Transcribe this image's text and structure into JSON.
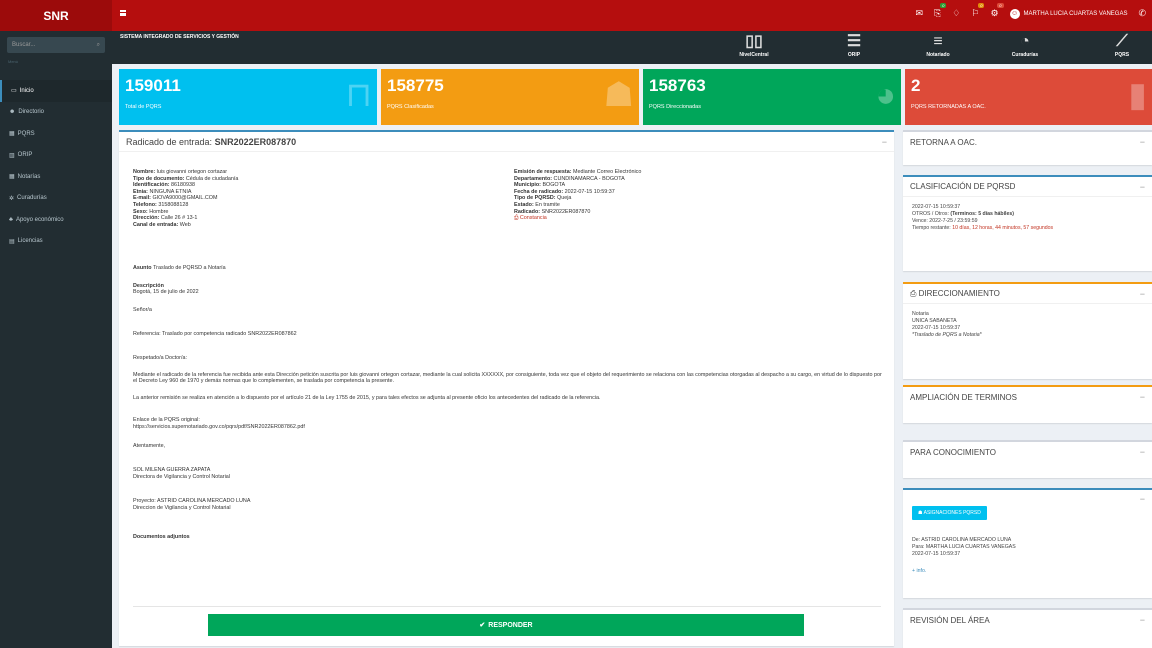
{
  "header": {
    "logo": "SNR",
    "user_name": "MARTHA LUCIA CUARTAS VANEGAS",
    "badges": {
      "b1": "0",
      "b2": "0",
      "b3": "0"
    }
  },
  "subheader": {
    "title": "SISTEMA INTEGRADO DE SERVICIOS Y GESTIÓN",
    "links": [
      "NivelCentral",
      "ORIP",
      "Notariado",
      "Curadurías",
      "PQRS"
    ]
  },
  "sidebar": {
    "search_placeholder": "Buscar...",
    "menu_header": "Menú",
    "items": [
      "Inicio",
      "Directorio",
      "PQRS",
      "ORIP",
      "Notarías",
      "Curadurías",
      "Apoyo económico",
      "Licencias"
    ]
  },
  "stats": [
    {
      "number": "159011",
      "label": "Total de PQRS",
      "color": "#00c0ef"
    },
    {
      "number": "158775",
      "label": "PQRS Clasificadas",
      "color": "#f39c12"
    },
    {
      "number": "158763",
      "label": "PQRS Direccionadas",
      "color": "#00a65a"
    },
    {
      "number": "2",
      "label": "PQRS RETORNADAS A OAC.",
      "color": "#dd4b39"
    }
  ],
  "main": {
    "title_prefix": "Radicado de entrada: ",
    "radicado": "SNR2022ER087870",
    "left": [
      {
        "k": "Nombre: ",
        "v": "luis giovanni ortegon cortazar"
      },
      {
        "k": "Tipo de documento: ",
        "v": "Cédula de ciudadanía"
      },
      {
        "k": "Identificación: ",
        "v": "86180938"
      },
      {
        "k": "Etnia: ",
        "v": "NINGUNA ETNIA"
      },
      {
        "k": "E-mail: ",
        "v": "GIOVA9000@GMAIL.COM"
      },
      {
        "k": "Telefono: ",
        "v": "3158088128"
      },
      {
        "k": "Sexo: ",
        "v": "Hombre"
      },
      {
        "k": "Dirección: ",
        "v": "Calle 26 # 13-1"
      },
      {
        "k": "Canal de entrada: ",
        "v": "Web"
      }
    ],
    "right": [
      {
        "k": "Emisión de respuesta: ",
        "v": "Mediante Correo Electrónico"
      },
      {
        "k": "Departamento: ",
        "v": "CUNDINAMARCA - BOGOTA"
      },
      {
        "k": "Municipio: ",
        "v": "BOGOTA"
      },
      {
        "k": "Fecha de radicado: ",
        "v": "2022-07-15 10:59:37"
      },
      {
        "k": "Tipo de PQRSD: ",
        "v": "Queja"
      },
      {
        "k": "Estado: ",
        "v": "En tramite"
      },
      {
        "k": "Radicado: ",
        "v": "SNR2022ER087870"
      }
    ],
    "constancia": "Constancia",
    "asunto_k": "Asunto ",
    "asunto_v": "Traslado de PQRSD a Notaría",
    "desc_title": "Descripción",
    "date_line": "Bogotá, 15 de julio de 2022",
    "senor": "Señor/a",
    "referencia": "Referencia: Traslado por competencia radicado SNR2022ER087862",
    "respetado": "Respetado/a Doctor/a:",
    "p1": "Mediante el radicado de la referencia fue recibida ante esta Dirección petición suscrita por luis giovanni ortegon cortazar, mediante la cual solicita XXXXXX, por consiguiente, toda vez que el objeto del requerimiento se relaciona con las competencias otorgadas al despacho a su cargo, en virtud de lo dispuesto por el Decreto Ley 960 de 1970 y demás normas que lo complementen, se traslada por competencia la presente.",
    "p2": "La anterior remisión se realiza en atención a lo dispuesto por el artículo 21 de la Ley 1755 de 2015, y para tales efectos se adjunta al presente oficio los antecedentes del radicado de la referencia.",
    "enlace": "Enlace de la PQRS original:",
    "url": "https://servicios.supernotariado.gov.co/pqrs/pdf/SNR2022ER087862.pdf",
    "atentamente": "Atentamente,",
    "firma_nombre": "SOL MILENA GUERRA ZAPATA",
    "firma_cargo": "Directora de Vigilancia y Control Notarial",
    "proyecto": "Proyecto: ASTRID CAROLINA MERCADO LUNA",
    "proyecto_cargo": "Direccion de Vigilancia y Control Notarial",
    "docs": "Documentos adjuntos",
    "responder": "RESPONDER"
  },
  "right_panel": {
    "retorna": "RETORNA A OAC.",
    "clasif_title": "CLASIFICACIÓN DE PQRSD",
    "clasif_date": "2022-07-15 10:59:37",
    "clasif_tipo": "OTROS / Otros: ",
    "clasif_terminos": "(Terminos: 5 días hábiles)",
    "clasif_vence": "Vence: 2022-7-25 / 23:59:59",
    "clasif_restante_k": "Tiempo restante: ",
    "clasif_restante_v": "10 días, 12 horas, 44 minutos, 57 segundos",
    "dir_title": "DIRECCIONAMIENTO",
    "dir_l1": "Notaria",
    "dir_l2": "UNICA SABANETA",
    "dir_l3": "2022-07-15 10:59:37",
    "dir_l4": "*Traslado de PQRS a Notaria*",
    "ampl_title": "AMPLIACIÓN DE TERMINOS",
    "conoc_title": "PARA CONOCIMIENTO",
    "asig_btn": "ASIGNACIONES PQRSD",
    "asig_de": "De: ASTRID CAROLINA MERCADO LUNA",
    "asig_para": "Para: MARTHA LUCIA CUARTAS VANEGAS",
    "asig_date": "2022-07-15 10:59:37",
    "asig_info": "+ info.",
    "revision_title": "REVISIÓN DEL ÁREA"
  }
}
